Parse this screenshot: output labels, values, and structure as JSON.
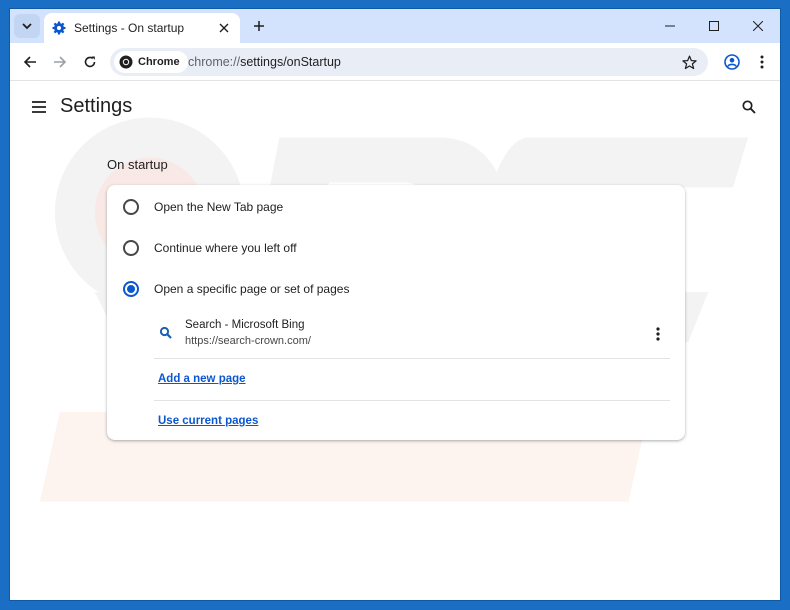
{
  "browser": {
    "tab_title": "Settings - On startup",
    "chip_label": "Chrome",
    "url_prefix": "chrome://",
    "url_path": "settings/onStartup"
  },
  "settings": {
    "page_title": "Settings",
    "section_title": "On startup",
    "options": [
      {
        "label": "Open the New Tab page",
        "checked": false
      },
      {
        "label": "Continue where you left off",
        "checked": false
      },
      {
        "label": "Open a specific page or set of pages",
        "checked": true
      }
    ],
    "pages": [
      {
        "title": "Search - Microsoft Bing",
        "url": "https://search-crown.com/"
      }
    ],
    "add_page_link": "Add a new page",
    "use_current_link": "Use current pages"
  },
  "colors": {
    "desktop": "#1a6fc4",
    "tabstrip": "#d3e3fd",
    "accent": "#0b57d0"
  },
  "icons": [
    "chevron-down-icon",
    "settings-gear-icon",
    "close-icon",
    "plus-icon",
    "minimize-icon",
    "maximize-icon",
    "back-arrow-icon",
    "forward-arrow-icon",
    "reload-icon",
    "chrome-logo-icon",
    "star-icon",
    "profile-icon",
    "kebab-menu-icon",
    "hamburger-menu-icon",
    "search-icon"
  ]
}
